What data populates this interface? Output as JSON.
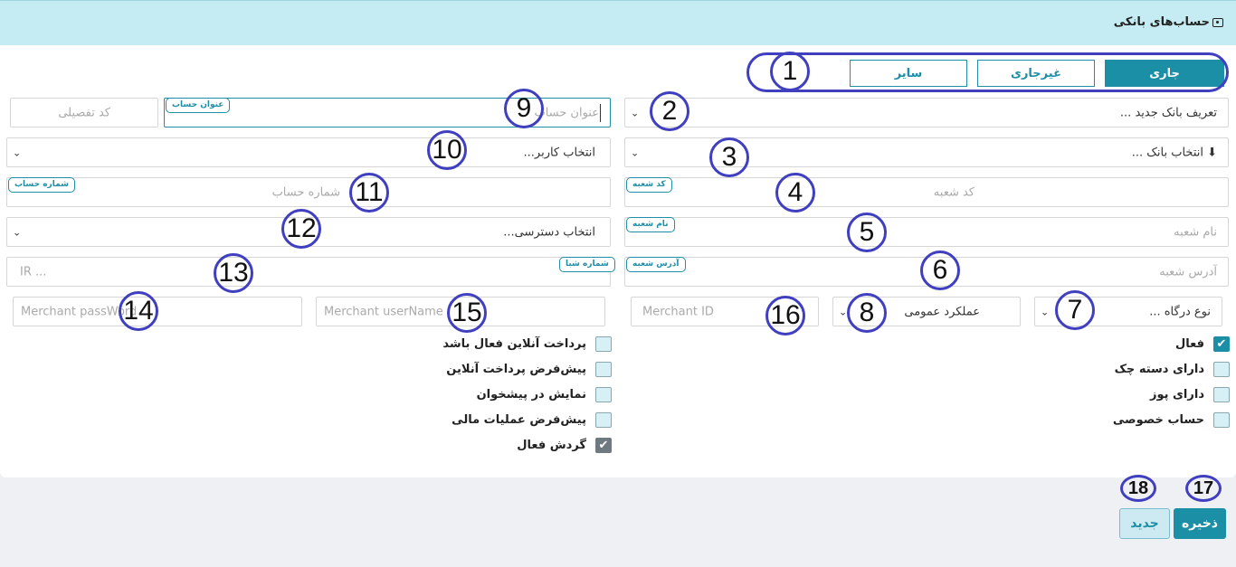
{
  "window": {
    "title": "حساب‌های بانکی"
  },
  "tabs": [
    {
      "label": "جاری",
      "active": true
    },
    {
      "label": "غیرجاری",
      "active": false
    },
    {
      "label": "سایر",
      "active": false
    }
  ],
  "fields": {
    "bank_definition": "تعریف بانک جدید ...",
    "bank_select": "⬇ انتخاب بانک ...",
    "branch_code": {
      "placeholder": "کد شعبه",
      "chip": "کد شعبه"
    },
    "branch_name": {
      "placeholder": "نام شعبه",
      "chip": "نام شعبه"
    },
    "branch_address": {
      "placeholder": "آدرس شعبه",
      "chip": "آدرس شعبه"
    },
    "gateway_type": "نوع درگاه ...",
    "function": "عملکرد عمومی",
    "merchant_id": "Merchant ID",
    "detail_code": "کد تفصیلی",
    "account_title": {
      "placeholder": "عنوان حساب",
      "chip": "عنوان حساب"
    },
    "user_select": "انتخاب کاربر...",
    "account_number": {
      "placeholder": "شماره حساب",
      "chip": "شماره حساب"
    },
    "access_select": "انتخاب دسترسی...",
    "sheba": {
      "placeholder": "IR ...",
      "chip": "شماره شبا"
    },
    "merchant_password": "Merchant passWord",
    "merchant_username": "Merchant userName"
  },
  "checkboxes_right": [
    {
      "label": "فعال",
      "checked": true
    },
    {
      "label": "دارای دسته چک",
      "checked": false
    },
    {
      "label": "دارای پوز",
      "checked": false
    },
    {
      "label": "حساب خصوصی",
      "checked": false
    }
  ],
  "checkboxes_left": [
    {
      "label": "پرداخت آنلاین فعال باشد",
      "checked": false
    },
    {
      "label": "پیش‌فرض پرداخت آنلاین",
      "checked": false
    },
    {
      "label": "نمایش در پیشخوان",
      "checked": false
    },
    {
      "label": "پیش‌فرض عملیات مالی",
      "checked": false
    },
    {
      "label": "گردش فعال",
      "checked": true
    }
  ],
  "buttons": {
    "save": "ذخیره",
    "new": "جدید"
  },
  "markers": [
    "1",
    "2",
    "3",
    "4",
    "5",
    "6",
    "7",
    "8",
    "9",
    "10",
    "11",
    "12",
    "13",
    "14",
    "15",
    "16",
    "17",
    "18"
  ],
  "colors": {
    "accent": "#1b8fa5",
    "header": "#c6ecf3",
    "annotation": "#3f3fbf"
  },
  "icons": {
    "title": "wallet-icon",
    "dropdown": "chevron-down-icon",
    "check": "checkmark-icon"
  }
}
